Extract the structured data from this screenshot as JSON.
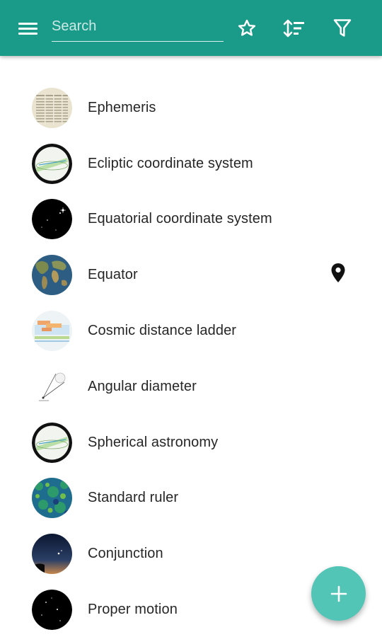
{
  "colors": {
    "app_bar": "#1a9a88",
    "fab": "#52c5b7",
    "text": "#262626",
    "background": "#ffffff"
  },
  "toolbar": {
    "menu_icon": "hamburger-menu-icon",
    "search_placeholder": "Search",
    "search_value": "",
    "favorites_icon": "star-outline-icon",
    "sort_icon": "sort-icon",
    "filter_icon": "filter-icon"
  },
  "items": [
    {
      "label": "Ephemeris",
      "thumbnail": "ephemeris-thumbnail"
    },
    {
      "label": "Ecliptic coordinate system",
      "thumbnail": "ecliptic-thumbnail"
    },
    {
      "label": "Equatorial coordinate system",
      "thumbnail": "equatorial-thumbnail"
    },
    {
      "label": "Equator",
      "thumbnail": "earth-map-thumbnail",
      "location_icon": "map-pin-icon"
    },
    {
      "label": "Cosmic distance ladder",
      "thumbnail": "distance-ladder-thumbnail"
    },
    {
      "label": "Angular diameter",
      "thumbnail": "angular-diameter-thumbnail"
    },
    {
      "label": "Spherical astronomy",
      "thumbnail": "spherical-astronomy-thumbnail"
    },
    {
      "label": "Standard ruler",
      "thumbnail": "cmb-thumbnail"
    },
    {
      "label": "Conjunction",
      "thumbnail": "night-sky-thumbnail"
    },
    {
      "label": "Proper motion",
      "thumbnail": "star-field-thumbnail"
    }
  ],
  "fab": {
    "icon": "plus-icon"
  }
}
